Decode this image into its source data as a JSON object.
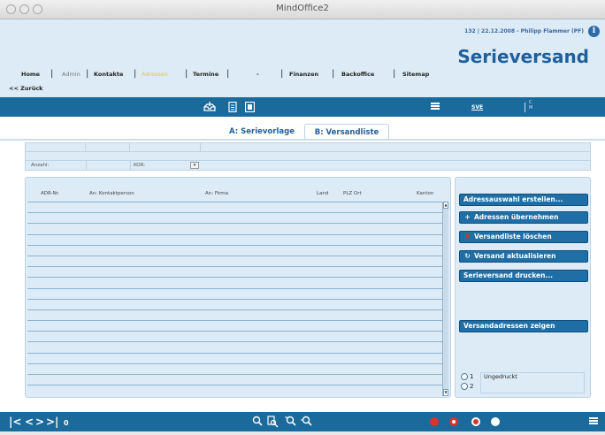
{
  "window": {
    "title": "MindOffice2"
  },
  "header": {
    "user_info": "132  |  22.12.2008  -  Philipp Flammer  (PF)",
    "page_title": "Serieversand",
    "back_link": "<< Zurück",
    "nav": [
      {
        "label": "Home"
      },
      {
        "label": "Admin"
      },
      {
        "label": "Kontakte"
      },
      {
        "label": "Adressen"
      },
      {
        "label": "Termine"
      },
      {
        "label": "-"
      },
      {
        "label": "Finanzen"
      },
      {
        "label": "Backoffice"
      },
      {
        "label": "Sitemap"
      }
    ],
    "active_nav": "Adressen"
  },
  "toolbar_top": {
    "code": "SVE",
    "c_label": "C",
    "m_label": "M"
  },
  "tabs": [
    {
      "label": "A: Serievorlage",
      "active": false
    },
    {
      "label": "B: Versandliste",
      "active": true
    }
  ],
  "filter": {
    "anzahl_label": "Anzahl:",
    "kor_label": "KOR:"
  },
  "table": {
    "columns": [
      "ADR-Nr.",
      "An: Kontaktperson",
      "An: Firma",
      "Land",
      "PLZ Ort",
      "Kanton"
    ],
    "rows": []
  },
  "actions": [
    {
      "label": "Adressauswahl erstellen...",
      "icon": ""
    },
    {
      "label": "Adressen übernehmen",
      "icon": "plus-icon"
    },
    {
      "label": "Versandliste löschen",
      "icon": "delete-icon"
    },
    {
      "label": "Versand aktualisieren",
      "icon": "refresh-icon"
    },
    {
      "label": "Serieversand drucken...",
      "icon": ""
    },
    {
      "label": "Versandadressen zeigen",
      "icon": ""
    }
  ],
  "print_status": {
    "options": [
      {
        "num": "1",
        "label": "Ungedruckt"
      },
      {
        "num": "2",
        "label": ""
      }
    ]
  },
  "toolbar_bottom": {
    "record_counter": "0"
  },
  "colors": {
    "toolbar": "#1b6a9c",
    "header_bg": "#dcebf6",
    "button": "#1f6fa6",
    "title": "#1f5f9c",
    "active_nav": "#e7c43a"
  }
}
